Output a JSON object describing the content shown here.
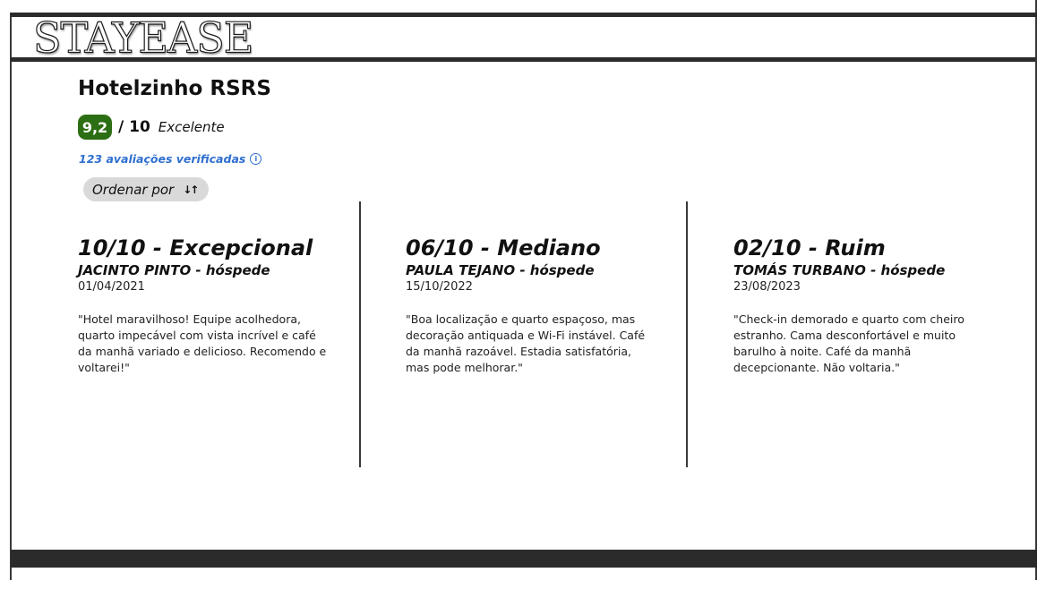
{
  "brand": {
    "logo_text": "STAYEASE"
  },
  "hotel": {
    "name": "Hotelzinho RSRS",
    "score": "9,2",
    "score_max": "/ 10",
    "score_label": "Excelente",
    "reviews_link": "123 avaliações verificadas",
    "info_icon": "info-icon",
    "sort_label": "Ordenar por",
    "sort_icon": "sort-arrows-icon"
  },
  "colors": {
    "score_badge": "#2c6e13",
    "link": "#2f6fd0",
    "sort_button_bg": "#d9d9d9",
    "bars": "#2b2b2b"
  },
  "reviews": [
    {
      "score_title": "10/10 - Excepcional",
      "author": "JACINTO PINTO - hóspede",
      "date": "01/04/2021",
      "text": "\"Hotel maravilhoso! Equipe acolhedora, quarto impecável com vista incrível e café da manhã variado e delicioso. Recomendo e voltarei!\""
    },
    {
      "score_title": "06/10 - Mediano",
      "author": "PAULA TEJANO - hóspede",
      "date": "15/10/2022",
      "text": "\"Boa localização e quarto espaçoso, mas decoração antiquada e Wi-Fi instável. Café da manhã razoável. Estadia satisfatória, mas pode melhorar.\""
    },
    {
      "score_title": "02/10 - Ruim",
      "author": "TOMÁS TURBANO - hóspede",
      "date": "23/08/2023",
      "text": "\"Check-in demorado e quarto com cheiro estranho. Cama desconfortável e muito barulho à noite. Café da manhã decepcionante. Não voltaria.\""
    }
  ]
}
